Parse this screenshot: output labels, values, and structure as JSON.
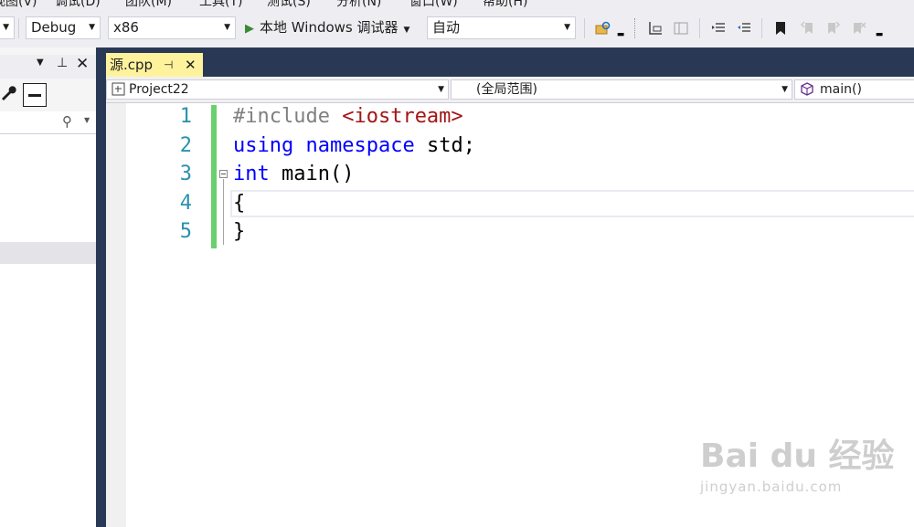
{
  "menu": {
    "items": [
      "视图(V)",
      "调试(D)",
      "团队(M)",
      "工具(T)",
      "测试(S)",
      "分析(N)",
      "窗口(W)",
      "帮助(H)"
    ]
  },
  "toolbar": {
    "config": "Debug",
    "platform": "x86",
    "run_label": "本地 Windows 调试器",
    "run_mode": "自动"
  },
  "editor_tab": {
    "filename": "源.cpp"
  },
  "navbar": {
    "project": "Project22",
    "scope": "(全局范围)",
    "member": "main()"
  },
  "code": {
    "line_numbers": [
      "1",
      "2",
      "3",
      "4",
      "5"
    ],
    "line1": {
      "directive": "#include",
      "header": "<iostream>"
    },
    "line2": {
      "kw1": "using",
      "kw2": "namespace",
      "rest": "std;"
    },
    "line3": {
      "kw": "int",
      "rest": "main()"
    },
    "line4": "{",
    "line5": "}"
  },
  "watermark": {
    "brand": "Bai du 经验",
    "site": "jingyan.baidu.com"
  },
  "colors": {
    "keyword": "#0000ff",
    "string": "#a31515",
    "preprocessor": "#808080",
    "line_number": "#2b91af",
    "tab_active": "#fff29d",
    "tabstrip": "#293955",
    "change_bar": "#6bd06b"
  },
  "icons": [
    "play-icon",
    "wrench-icon",
    "search-icon",
    "pin-icon",
    "close-icon",
    "class-icon",
    "method-icon",
    "bookmark-icon",
    "fold-icon"
  ]
}
